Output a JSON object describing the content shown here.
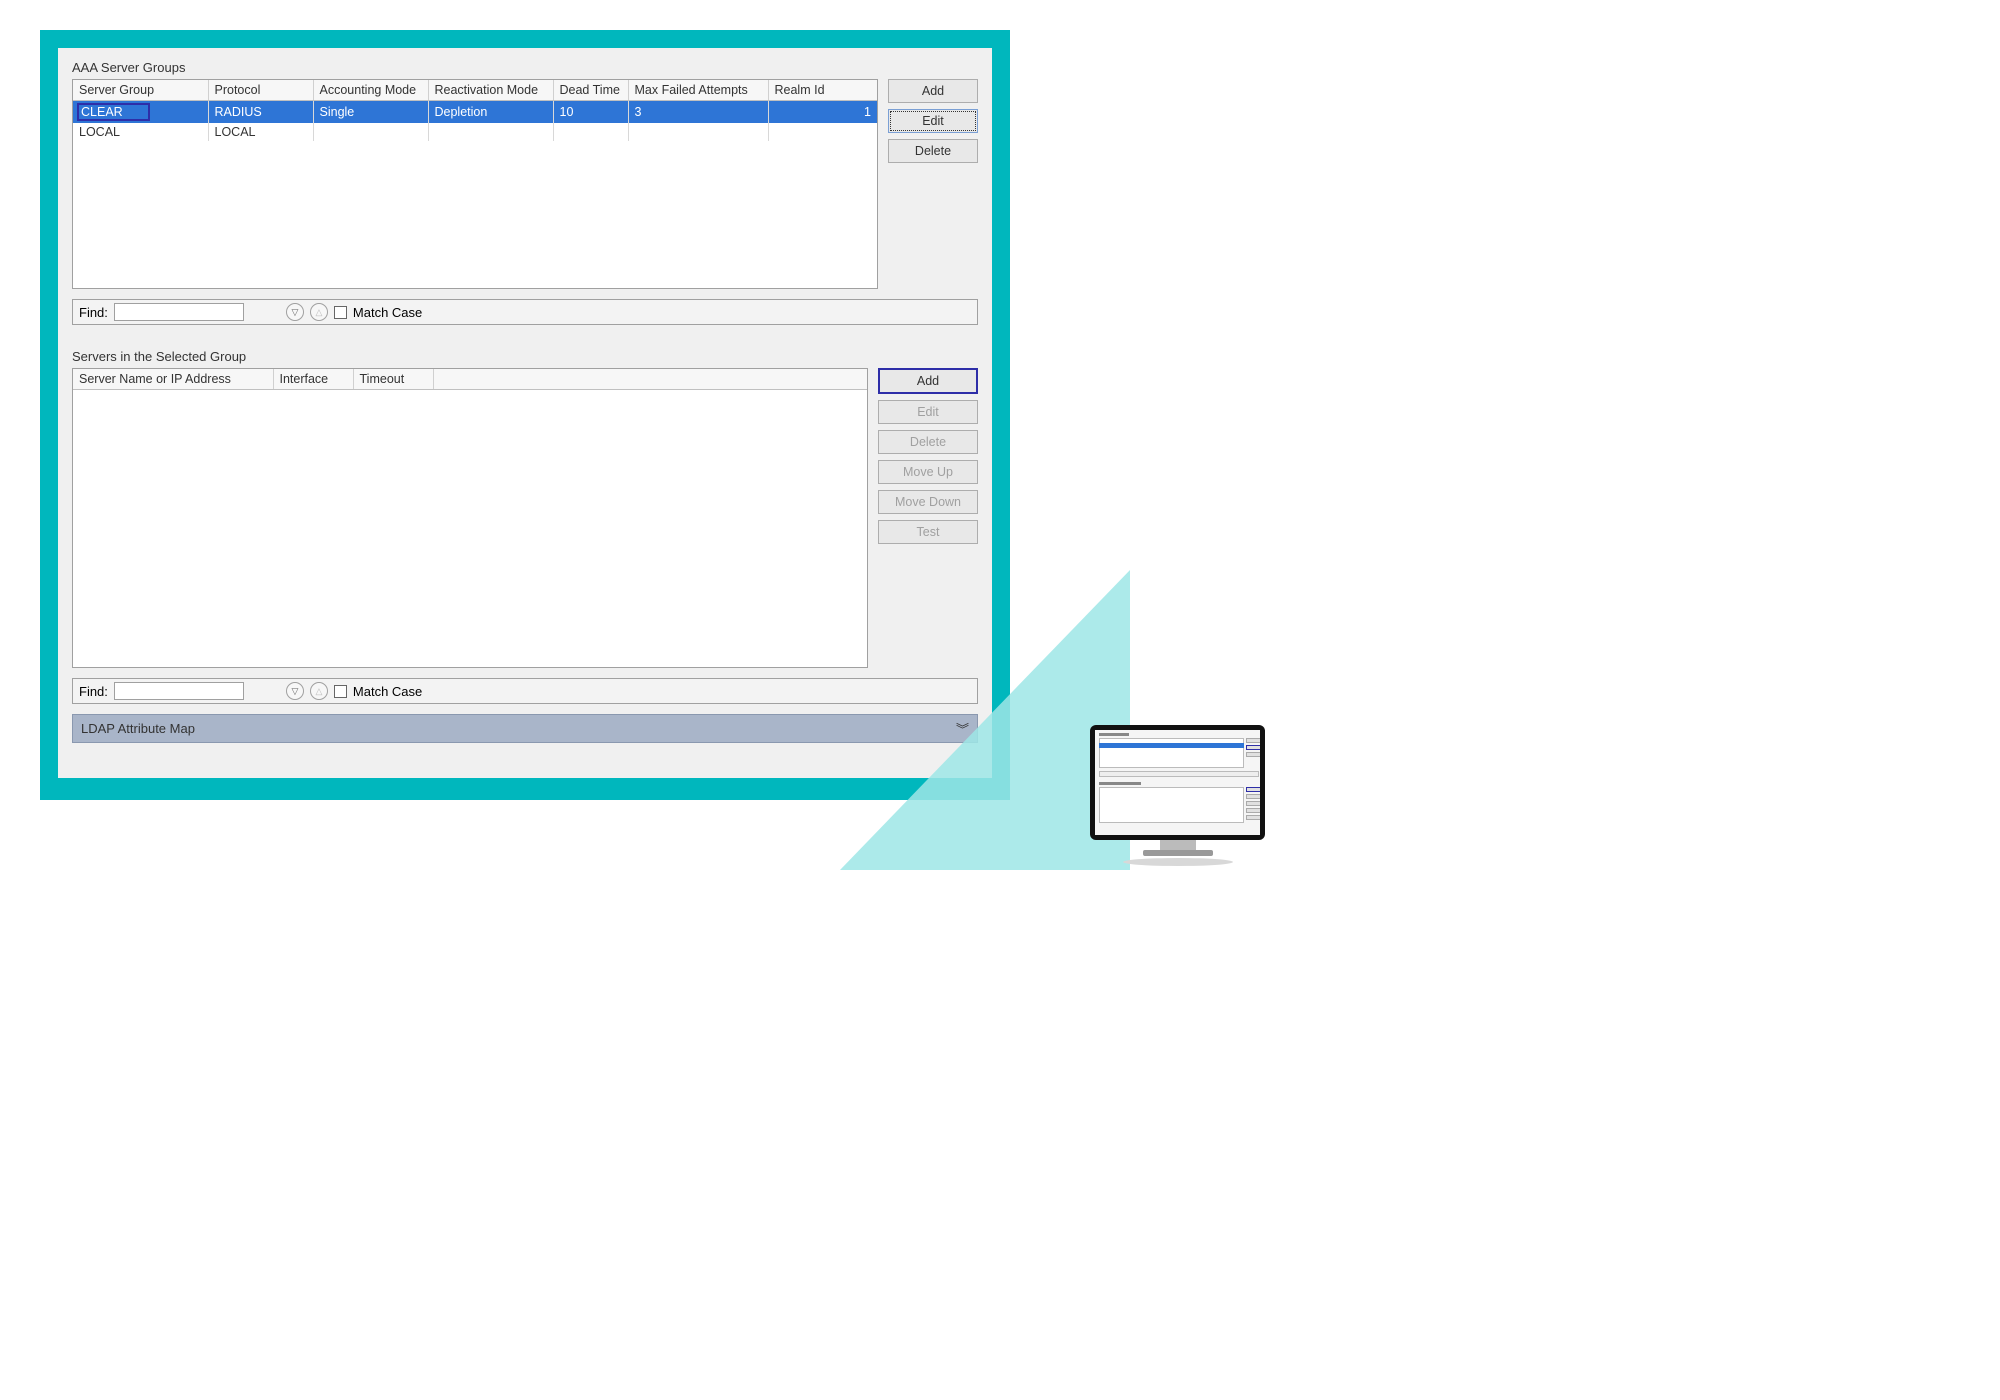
{
  "section1": {
    "title": "AAA Server Groups",
    "columns": [
      "Server Group",
      "Protocol",
      "Accounting Mode",
      "Reactivation Mode",
      "Dead Time",
      "Max Failed Attempts",
      "Realm Id"
    ],
    "rows": [
      {
        "server_group": "CLEAR",
        "protocol": "RADIUS",
        "accounting_mode": "Single",
        "reactivation_mode": "Depletion",
        "dead_time": "10",
        "max_failed": "3",
        "realm_id": "1",
        "selected": true,
        "highlight_first_cell": true
      },
      {
        "server_group": "LOCAL",
        "protocol": "LOCAL",
        "accounting_mode": "",
        "reactivation_mode": "",
        "dead_time": "",
        "max_failed": "",
        "realm_id": "",
        "selected": false
      }
    ],
    "buttons": {
      "add": "Add",
      "edit": "Edit",
      "delete": "Delete"
    }
  },
  "section2": {
    "title": "Servers in the Selected Group",
    "columns": [
      "Server Name or IP Address",
      "Interface",
      "Timeout"
    ],
    "rows": [],
    "buttons": {
      "add": "Add",
      "edit": "Edit",
      "delete": "Delete",
      "move_up": "Move Up",
      "move_down": "Move Down",
      "test": "Test"
    }
  },
  "find": {
    "label": "Find:",
    "match_case": "Match Case"
  },
  "ldap": {
    "label": "LDAP Attribute Map"
  }
}
